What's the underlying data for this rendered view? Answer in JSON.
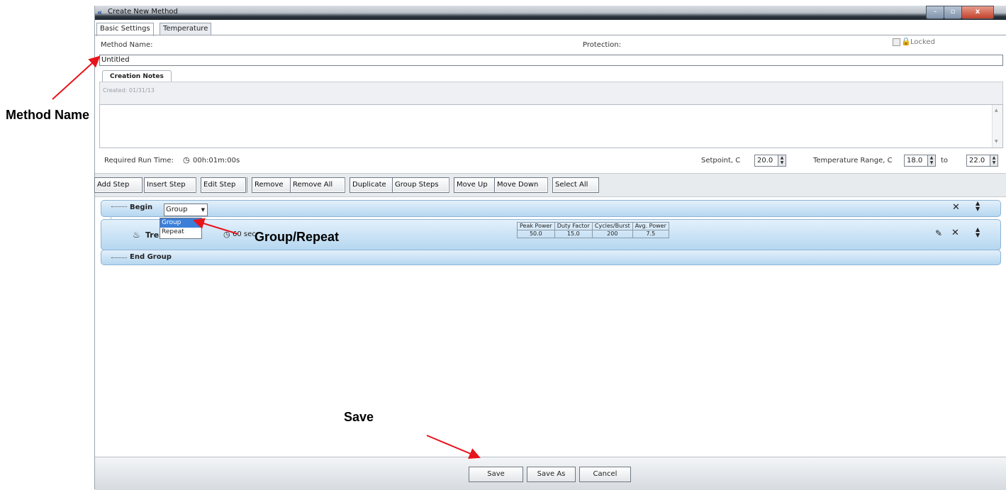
{
  "window": {
    "title": "Create New Method",
    "app_icon_glyph": "«",
    "min_glyph": "–",
    "max_glyph": "▫",
    "close_glyph": "x"
  },
  "tabs": [
    {
      "label": "Basic Settings"
    },
    {
      "label": "Temperature"
    }
  ],
  "basic": {
    "method_name_label": "Method Name:",
    "protection_label": "Protection:",
    "locked_label": "Locked",
    "method_name_value": "Untitled",
    "notes_tab_label": "Creation Notes",
    "created_text": "Created: 01/31/13",
    "run_time_label": "Required Run Time:",
    "run_time_value": "00h:01m:00s",
    "setpoint_label": "Setpoint, C",
    "setpoint_value": "20.0",
    "temp_range_label": "Temperature Range, C",
    "temp_range_min": "18.0",
    "to_label": "to",
    "temp_range_max": "22.0"
  },
  "toolbar": {
    "add_step": "Add Step",
    "insert_step": "Insert Step",
    "edit_step": "Edit Step",
    "remove": "Remove",
    "remove_all": "Remove All",
    "duplicate": "Duplicate",
    "group_steps": "Group Steps",
    "move_up": "Move Up",
    "move_down": "Move Down",
    "select_all": "Select All"
  },
  "steps": {
    "begin_label": "Begin",
    "group_select_value": "Group",
    "dropdown_options": [
      "Group",
      "Repeat"
    ],
    "treatment_label": "Tre",
    "duration_text": "60 sec",
    "params_headers": [
      "Peak Power",
      "Duty Factor",
      "Cycles/Burst",
      "Avg. Power"
    ],
    "params_values": [
      "50.0",
      "15.0",
      "200",
      "7.5"
    ],
    "end_label": "End Group"
  },
  "bottom": {
    "save": "Save",
    "save_as": "Save As",
    "cancel": "Cancel"
  },
  "annotations": {
    "method_name": "Method Name",
    "group_repeat": "Group/Repeat",
    "save": "Save",
    "arrow_color": "#e8141c"
  }
}
